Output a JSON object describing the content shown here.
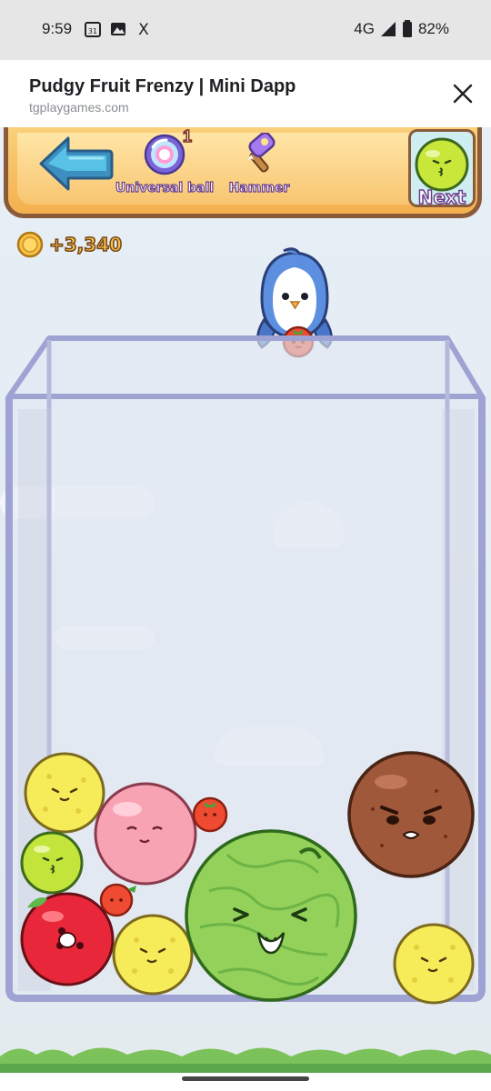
{
  "status_bar": {
    "time": "9:59",
    "network": "4G",
    "battery": "82%",
    "icons": [
      "calendar-icon",
      "gallery-icon",
      "x-icon",
      "signal-icon",
      "battery-icon"
    ],
    "calendar_day": "31",
    "x_glyph": "X"
  },
  "browser": {
    "title": "Pudgy Fruit Frenzy | Mini Dapp",
    "url": "tgplaygames.com"
  },
  "game": {
    "tools": {
      "universal_label": "Universal ball",
      "universal_count": "1",
      "hammer_label": "Hammer"
    },
    "next_label": "Next",
    "score": "+3,340",
    "held_fruit": "tomato",
    "next_fruit": "lime",
    "fruits": [
      "lemon",
      "peach",
      "tomato",
      "lime",
      "tomato",
      "watermelon",
      "coconut",
      "apple",
      "lemon",
      "lemon"
    ],
    "colors": {
      "toolbar": "#f4b04f",
      "container": "#9aa0cf",
      "coin": "#f7c44a"
    }
  }
}
